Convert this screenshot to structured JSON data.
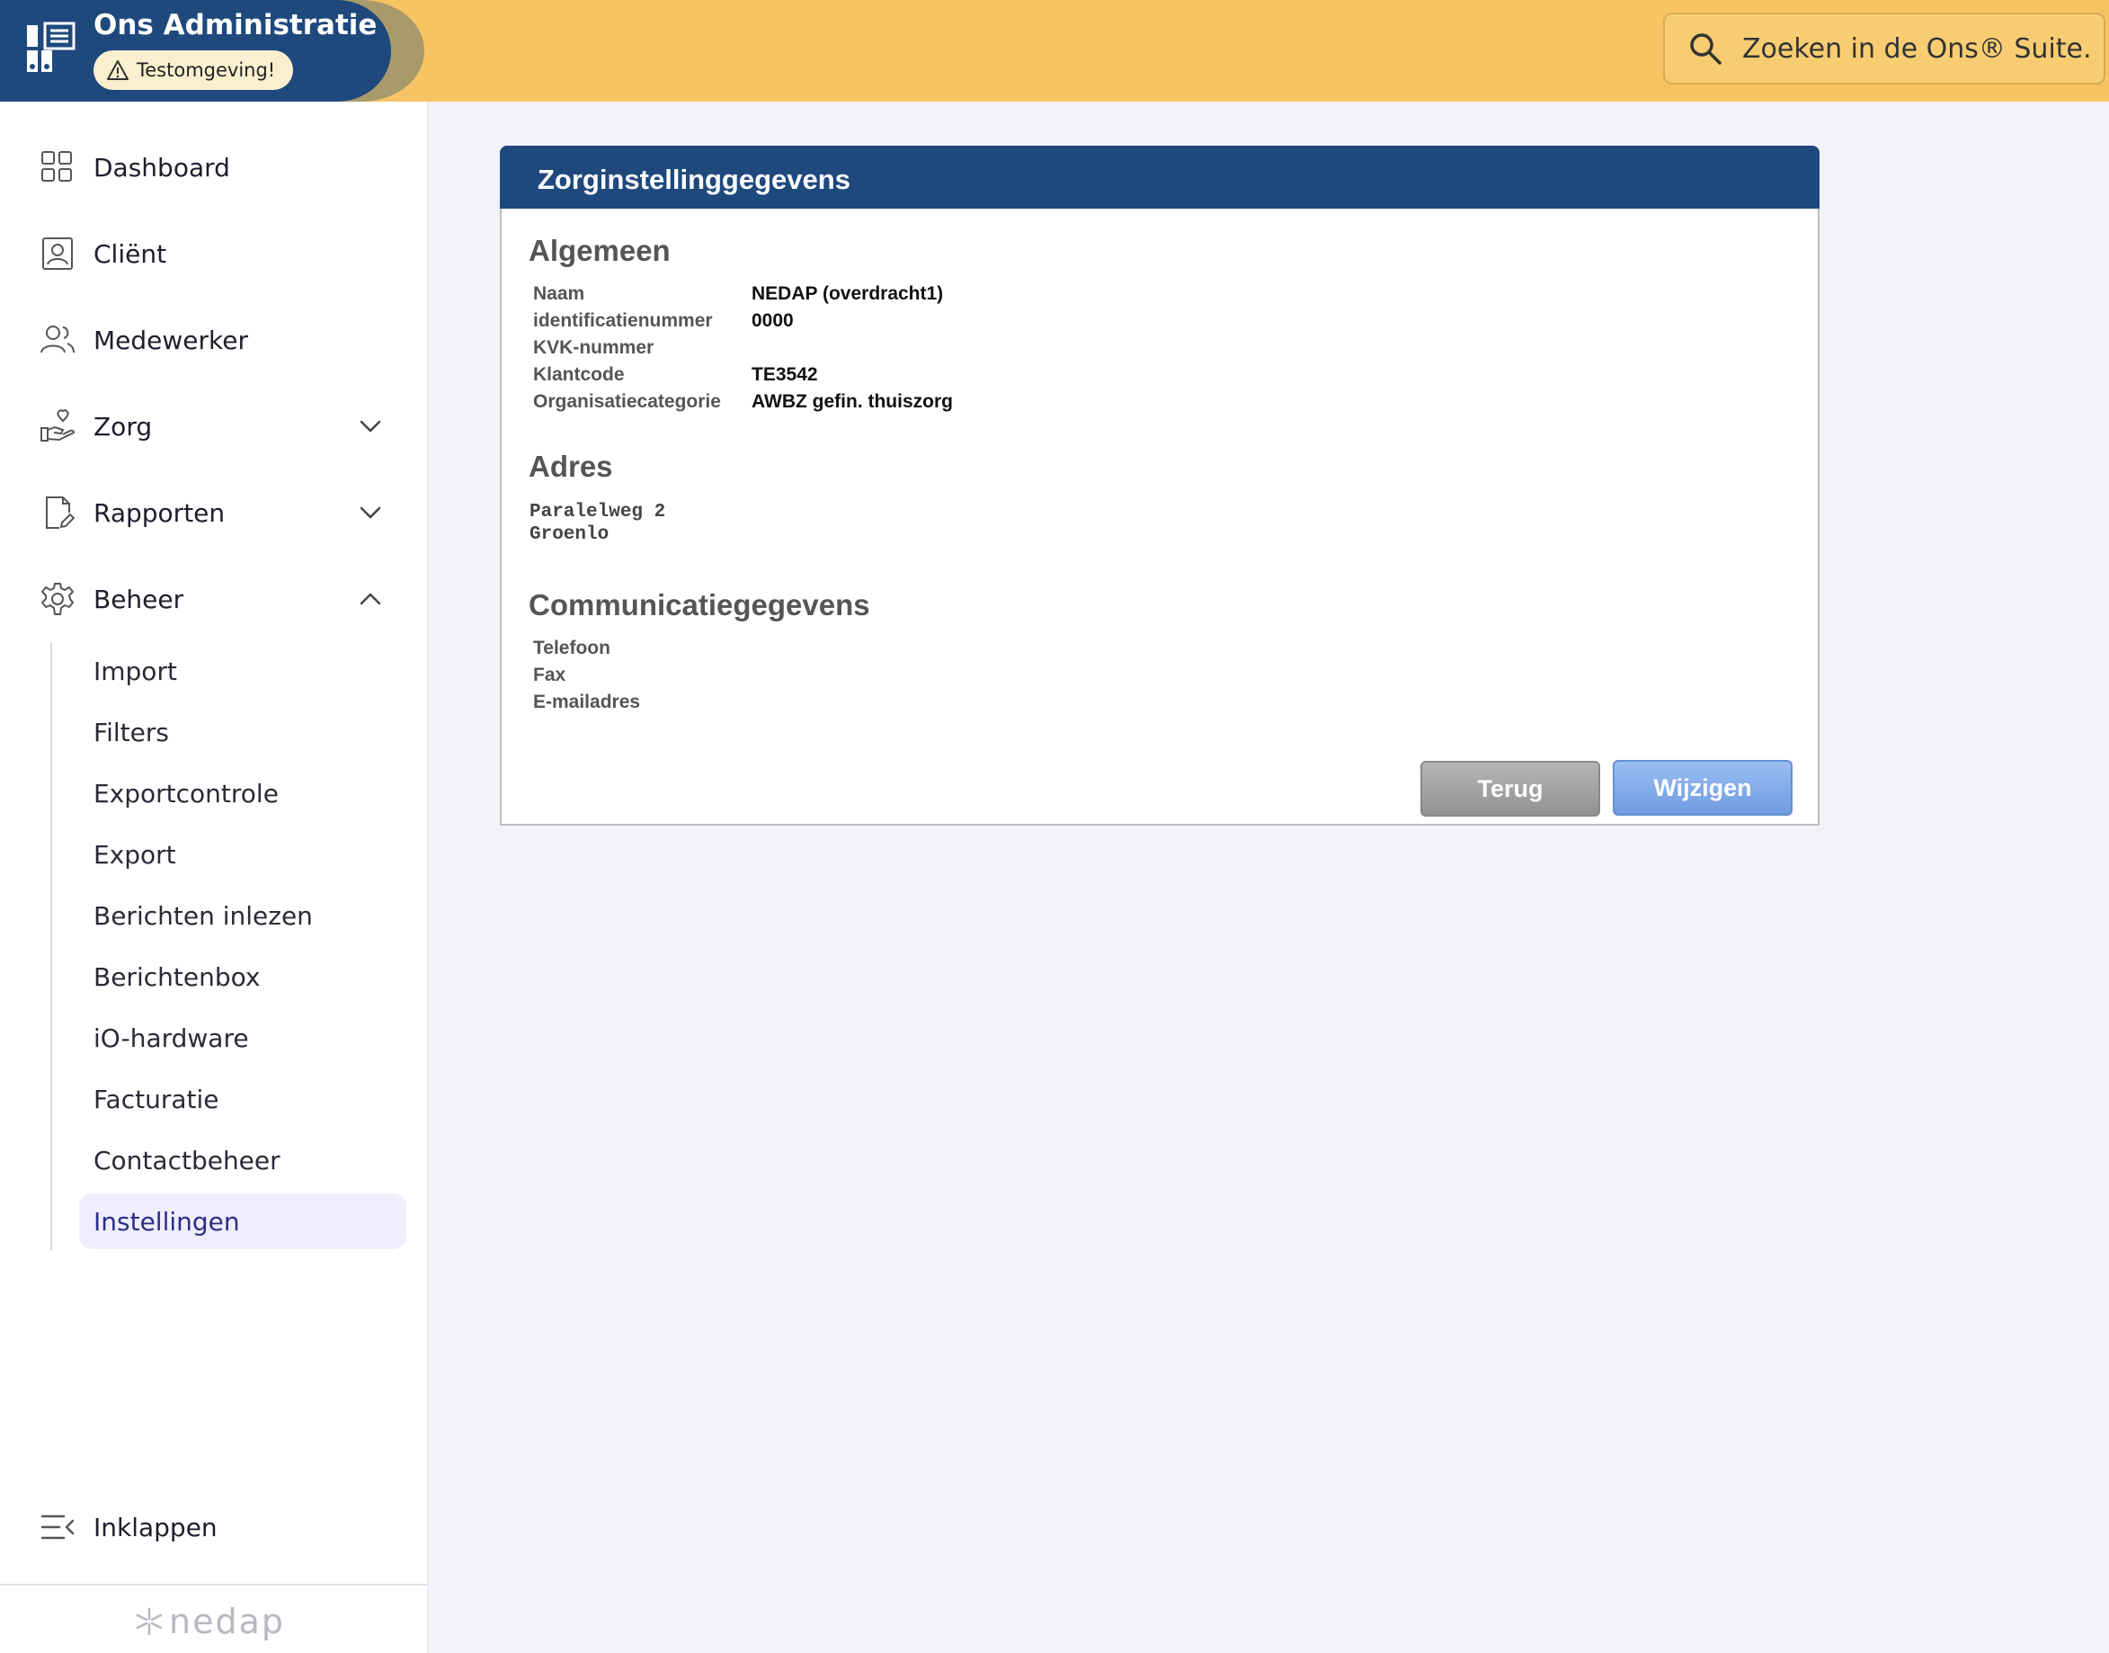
{
  "app": {
    "title": "Ons Administratie",
    "environment_badge": "Testomgeving!",
    "search_placeholder": "Zoeken in de Ons® Suite..."
  },
  "sidebar": {
    "items": [
      {
        "label": "Dashboard",
        "icon": "grid-icon"
      },
      {
        "label": "Cliënt",
        "icon": "client-card-icon"
      },
      {
        "label": "Medewerker",
        "icon": "users-icon"
      },
      {
        "label": "Zorg",
        "icon": "care-hand-heart-icon",
        "expanded": false
      },
      {
        "label": "Rapporten",
        "icon": "report-edit-icon",
        "expanded": false
      },
      {
        "label": "Beheer",
        "icon": "gear-icon",
        "expanded": true
      }
    ],
    "beheer_subitems": [
      "Import",
      "Filters",
      "Exportcontrole",
      "Export",
      "Berichten inlezen",
      "Berichtenbox",
      "iO-hardware",
      "Facturatie",
      "Contactbeheer",
      "Instellingen"
    ],
    "active_subitem": "Instellingen",
    "collapse_label": "Inklappen",
    "footer_logo": "nedap"
  },
  "panel": {
    "title": "Zorginstellinggegevens",
    "sections": {
      "algemeen": {
        "title": "Algemeen",
        "fields": [
          {
            "label": "Naam",
            "value": "NEDAP (overdracht1)"
          },
          {
            "label": "identificatienummer",
            "value": "0000"
          },
          {
            "label": "KVK-nummer",
            "value": ""
          },
          {
            "label": "Klantcode",
            "value": "TE3542"
          },
          {
            "label": "Organisatiecategorie",
            "value": "AWBZ gefin. thuiszorg"
          }
        ]
      },
      "adres": {
        "title": "Adres",
        "lines": [
          "Paralelweg 2",
          "Groenlo"
        ]
      },
      "communicatie": {
        "title": "Communicatiegegevens",
        "fields": [
          {
            "label": "Telefoon",
            "value": ""
          },
          {
            "label": "Fax",
            "value": ""
          },
          {
            "label": "E-mailadres",
            "value": ""
          }
        ]
      }
    },
    "buttons": {
      "back": "Terug",
      "edit": "Wijzigen"
    }
  },
  "colors": {
    "topbar": "#f6c462",
    "brand_navy": "#1f497d",
    "active_bg": "#f0eefc",
    "active_text": "#2a2f85"
  }
}
